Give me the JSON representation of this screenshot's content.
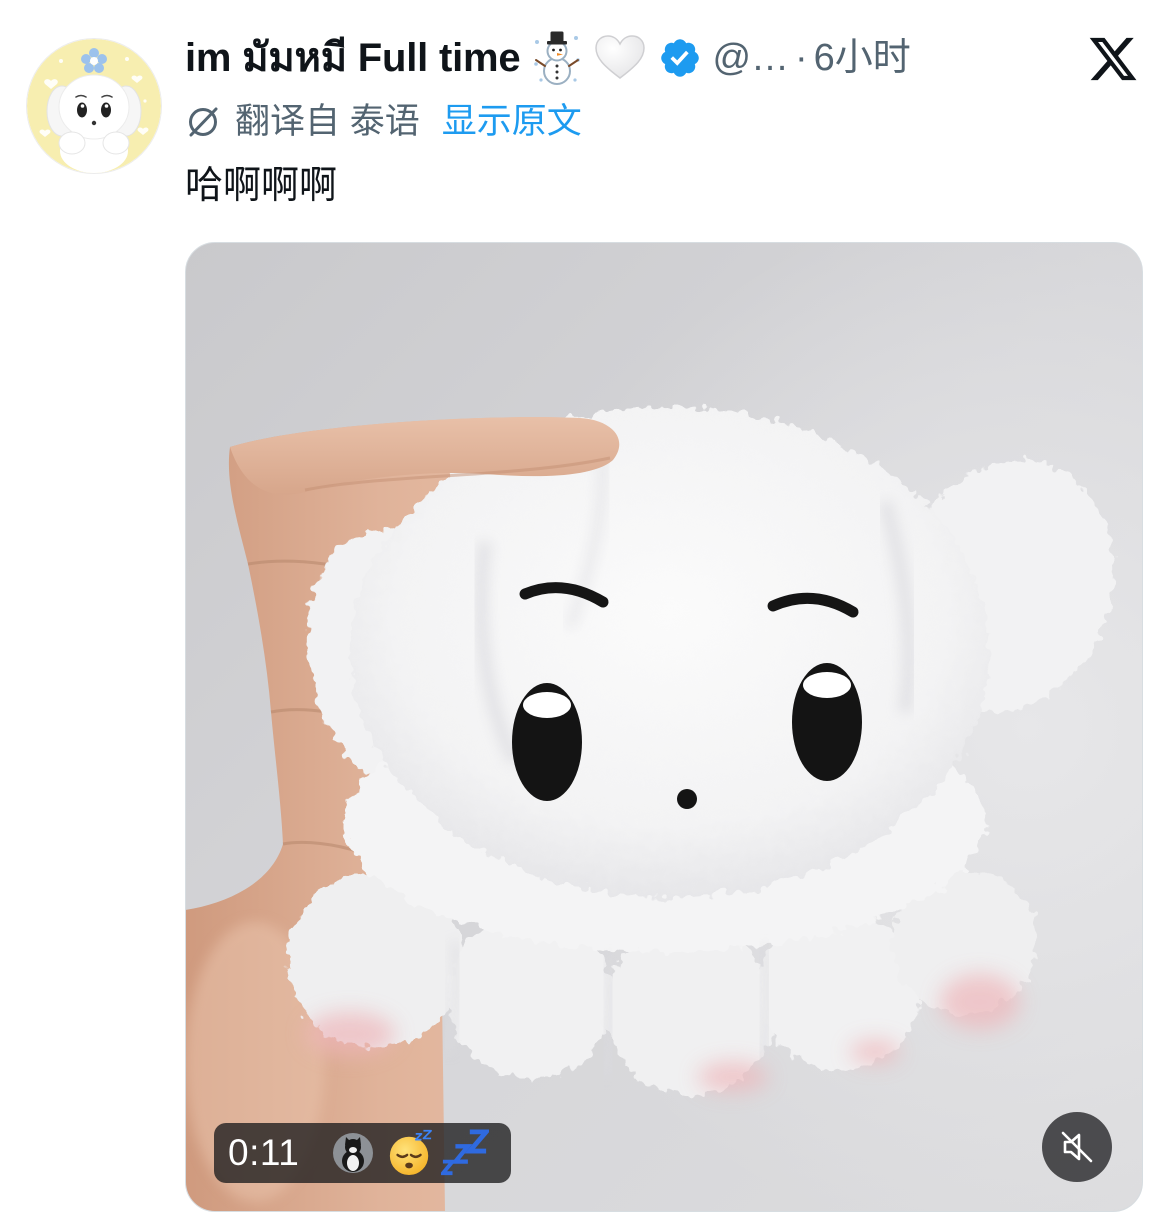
{
  "tweet": {
    "author": {
      "avatar_icon": "plush-puppy-avatar",
      "display_name": "im มัมหมี Full time",
      "name_emojis": [
        "snowman-icon",
        "white-heart-icon"
      ],
      "verified_icon": "verified-badge-icon",
      "handle": "@…",
      "separator": "·",
      "timestamp": "6小时"
    },
    "platform_icon": "x-logo-icon",
    "translation": {
      "icon": "translate-icon",
      "label": "翻译自 泰语",
      "show_original": "显示原文"
    },
    "text": "哈啊啊啊",
    "media": {
      "duration": "0:11",
      "overlay_emojis": [
        "cat-sticker-icon",
        "sleeping-face-icon",
        "zzz-icon"
      ],
      "mute_icon": "muted-speaker-icon"
    }
  },
  "colors": {
    "text_primary": "#0f1419",
    "text_secondary": "#536471",
    "link": "#1d9bf0",
    "verified": "#1d9bf0",
    "avatar_background": "#f7eeb0",
    "overlay_background": "#1c1c1e"
  }
}
